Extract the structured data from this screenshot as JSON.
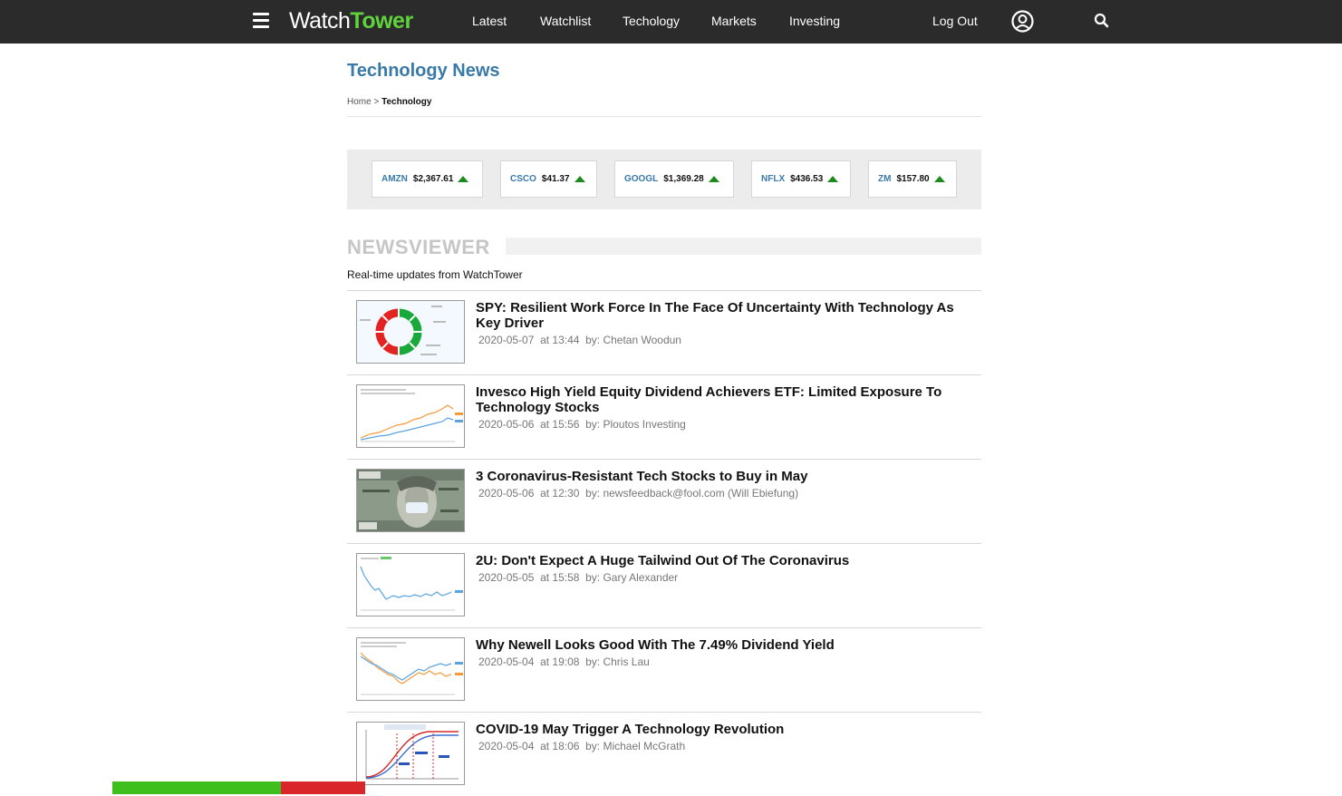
{
  "header": {
    "logo_part1": "Watch",
    "logo_part2": "Tower",
    "nav": [
      "Latest",
      "Watchlist",
      "Techology",
      "Markets",
      "Investing"
    ],
    "logout": "Log Out"
  },
  "page": {
    "title": "Technology News",
    "breadcrumb_home": "Home",
    "breadcrumb_sep": ">",
    "breadcrumb_current": "Technology"
  },
  "tickers": [
    {
      "symbol": "AMZN",
      "price": "$2,367.61",
      "trend": "up"
    },
    {
      "symbol": "CSCO",
      "price": "$41.37",
      "trend": "up"
    },
    {
      "symbol": "GOOGL",
      "price": "$1,369.28",
      "trend": "up"
    },
    {
      "symbol": "NFLX",
      "price": "$436.53",
      "trend": "up"
    },
    {
      "symbol": "ZM",
      "price": "$157.80",
      "trend": "up"
    }
  ],
  "newsviewer": {
    "title": "NEWSVIEWER",
    "subtitle": "Real-time updates from WatchTower"
  },
  "news": [
    {
      "headline": "SPY: Resilient Work Force In The Face Of Uncertainty With Technology As Key Driver",
      "date": "2020-05-07",
      "time": "at 13:44",
      "author": "by: Chetan Woodun",
      "thumb": "donut-chart"
    },
    {
      "headline": "Invesco High Yield Equity Dividend Achievers ETF: Limited Exposure To Technology Stocks",
      "date": "2020-05-06",
      "time": "at 15:56",
      "author": "by: Ploutos Investing",
      "thumb": "line-chart"
    },
    {
      "headline": "3 Coronavirus-Resistant Tech Stocks to Buy in May",
      "date": "2020-05-06",
      "time": "at 12:30",
      "author": "by: newsfeedback@fool.com (Will Ebiefung)",
      "thumb": "banknote-photo"
    },
    {
      "headline": "2U: Don't Expect A Huge Tailwind Out Of The Coronavirus",
      "date": "2020-05-05",
      "time": "at 15:58",
      "author": "by: Gary Alexander",
      "thumb": "line-chart"
    },
    {
      "headline": "Why Newell Looks Good With The 7.49% Dividend Yield",
      "date": "2020-05-04",
      "time": "at 19:08",
      "author": "by: Chris Lau",
      "thumb": "line-chart"
    },
    {
      "headline": "COVID-19 May Trigger A Technology Revolution",
      "date": "2020-05-04",
      "time": "at 18:06",
      "author": "by: Michael McGrath",
      "thumb": "s-curve-chart"
    }
  ],
  "colors": {
    "nav_bg": "#2b2b2b",
    "accent_blue": "#3979a8",
    "logo_green": "#5fd23c",
    "up_green": "#1e8a1e"
  },
  "icons": {
    "menu": "hamburger-icon",
    "account": "user-circle-icon",
    "search": "search-icon",
    "trend": "up-triangle-icon"
  }
}
